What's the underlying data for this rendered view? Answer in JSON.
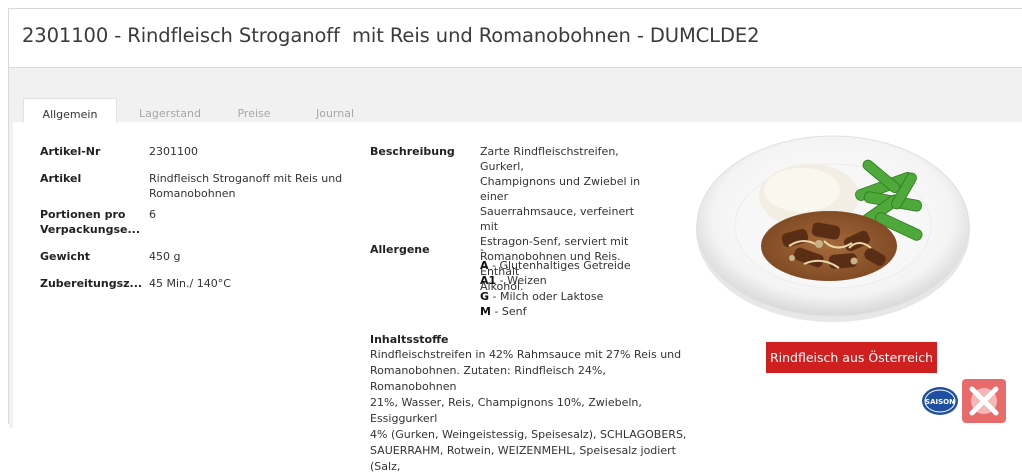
{
  "header": {
    "title": "2301100 - Rindfleisch Stroganoff  mit Reis und Romanobohnen - DUMCLDE2"
  },
  "tabs": [
    {
      "label": "Allgemein",
      "active": true
    },
    {
      "label": "Lagerstand",
      "active": false
    },
    {
      "label": "Preise",
      "active": false
    },
    {
      "label": "Journal",
      "active": false
    }
  ],
  "details": {
    "artikel_nr": {
      "label": "Artikel-Nr",
      "value": "2301100"
    },
    "artikel": {
      "label": "Artikel",
      "value_line1": "Rindfleisch Stroganoff mit Reis und",
      "value_line2": "Romanobohnen"
    },
    "portionen": {
      "label_line1": "Portionen pro",
      "label_line2": "Verpackungse...",
      "value": "6"
    },
    "gewicht": {
      "label": "Gewicht",
      "value": "450 g"
    },
    "zubereitung": {
      "label": "Zubereitungsz...",
      "value": "45 Min./ 140°C"
    }
  },
  "beschreibung": {
    "label": "Beschreibung",
    "lines": [
      "Zarte Rindfleischstreifen, Gurkerl,",
      "Champignons und Zwiebel in einer",
      "Sauerrahmsauce, verfeinert mit",
      "Estragon-Senf, serviert mit",
      "Romanobohnen und Reis. Enthält",
      "Alkohol."
    ]
  },
  "allergene": {
    "label": "Allergene",
    "dash": "-",
    "items": [
      {
        "code": "A",
        "text": " - Glutenhaltiges Getreide"
      },
      {
        "code": "A1",
        "text": " - Weizen"
      },
      {
        "code": "G",
        "text": " - Milch oder Laktose"
      },
      {
        "code": "M",
        "text": " - Senf"
      }
    ]
  },
  "inhaltsstoffe": {
    "label": "Inhaltsstoffe",
    "lines": [
      "Rindfleischstreifen in 42% Rahmsauce mit 27% Reis und",
      "Romanobohnen. Zutaten: Rindfleisch 24%, Romanobohnen",
      "21%, Wasser, Reis, Champignons 10%, Zwiebeln, Essiggurkerl",
      "4% (Gurken, Weingeistessig, Speisesalz), SCHLAGOBERS,",
      "SAUERRAHM, Rotwein, WEIZENMEHL, Speisesalz jodiert (Salz,"
    ]
  },
  "origin_button": {
    "label": "Rindfleisch aus Österreich"
  },
  "badges": {
    "saison": "SAISON"
  },
  "colors": {
    "accent_red": "#cf1f1f",
    "saison_blue": "#1f4fa3"
  }
}
